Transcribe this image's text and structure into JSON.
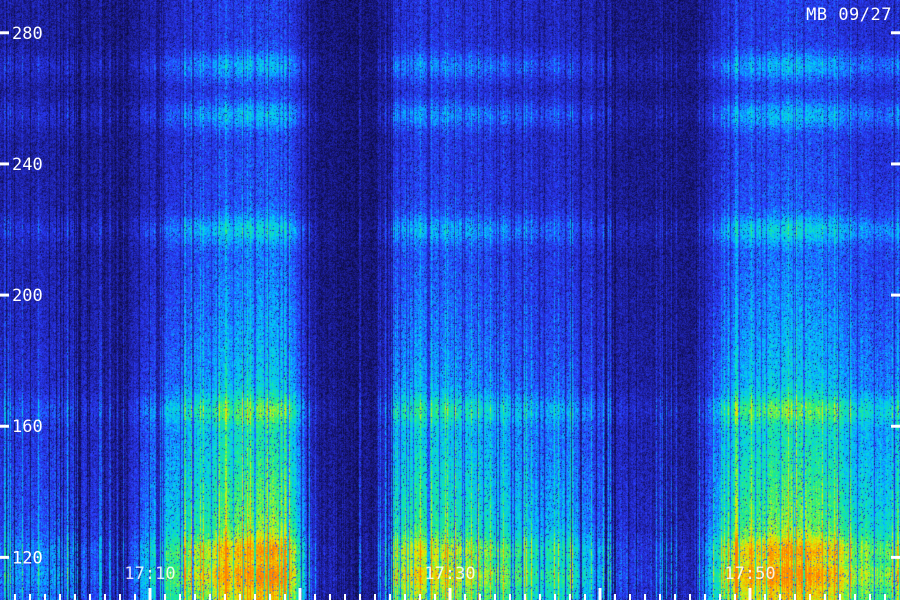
{
  "corner_label": "MB 09/27",
  "chart_data": {
    "type": "heatmap",
    "title": "",
    "xlabel": "",
    "ylabel": "",
    "ylim": [
      107,
      290
    ],
    "yticks": [
      120,
      160,
      200,
      240,
      280
    ],
    "ytick_labels": [
      "120",
      "160",
      "200",
      "240",
      "280"
    ],
    "xlim": [
      "17:00",
      "18:00"
    ],
    "xticks": [
      "17:10",
      "17:30",
      "17:50"
    ],
    "xtick_labels": [
      "17:10",
      "17:30",
      "17:50"
    ],
    "colorscale": [
      "#05051a",
      "#1a1a8c",
      "#2a3cff",
      "#00c8ff",
      "#20f080",
      "#e8f000",
      "#ff8000"
    ],
    "band_centers": [
      115,
      122,
      165,
      220,
      255,
      270
    ],
    "intensity_profile": [
      {
        "t": "17:00",
        "level": 0.3
      },
      {
        "t": "17:05",
        "level": 0.35
      },
      {
        "t": "17:08",
        "level": 0.05
      },
      {
        "t": "17:10",
        "level": 0.5
      },
      {
        "t": "17:15",
        "level": 0.85
      },
      {
        "t": "17:19",
        "level": 0.95
      },
      {
        "t": "17:21",
        "level": 0.1
      },
      {
        "t": "17:25",
        "level": 0.05
      },
      {
        "t": "17:27",
        "level": 0.8
      },
      {
        "t": "17:31",
        "level": 0.7
      },
      {
        "t": "17:35",
        "level": 0.55
      },
      {
        "t": "17:38",
        "level": 0.5
      },
      {
        "t": "17:42",
        "level": 0.2
      },
      {
        "t": "17:46",
        "level": 0.1
      },
      {
        "t": "17:49",
        "level": 0.8
      },
      {
        "t": "17:53",
        "level": 0.95
      },
      {
        "t": "17:57",
        "level": 0.7
      },
      {
        "t": "18:00",
        "level": 0.6
      }
    ]
  }
}
